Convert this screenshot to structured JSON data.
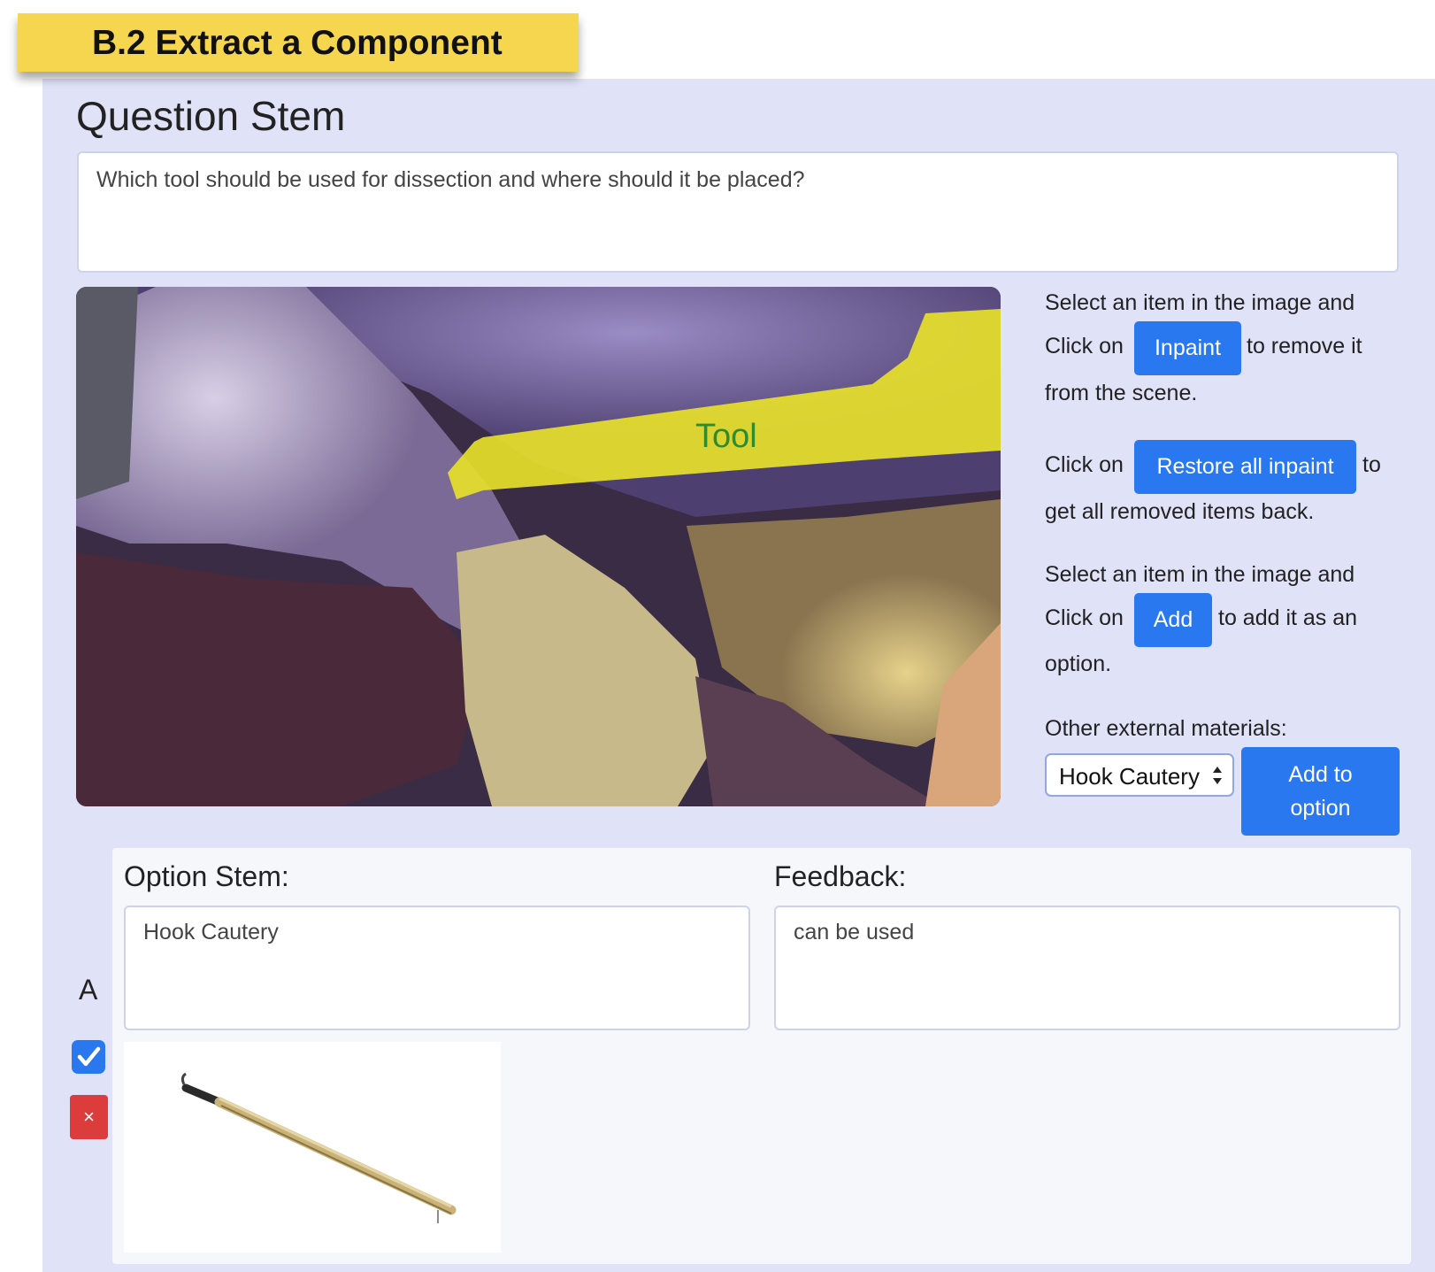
{
  "banner": {
    "title": "B.2 Extract a Component"
  },
  "question": {
    "heading": "Question Stem",
    "text": "Which tool should be used for dissection and where should it be placed?"
  },
  "scene": {
    "overlay_label": "Tool",
    "overlay_color": "#e6e02a"
  },
  "instructions": {
    "block1_line1": "Select an item in the image and",
    "block1_click_on": "Click on",
    "inpaint_button": "Inpaint",
    "block1_after": "to remove it",
    "block1_line3": "from the scene.",
    "block2_click_on": "Click on",
    "restore_button": "Restore all inpaint",
    "block2_after": "to",
    "block2_line2": "get all removed items back.",
    "block3_line1": "Select an item in the image and",
    "block3_click_on": "Click on",
    "add_button": "Add",
    "block3_after": "to add it as an",
    "block3_line3": "option.",
    "external_label": "Other external materials:",
    "external_select_value": "Hook Cautery",
    "add_to_option_line1": "Add to",
    "add_to_option_line2": "option"
  },
  "option": {
    "letter": "A",
    "stem_label": "Option Stem:",
    "stem_value": "Hook Cautery",
    "feedback_label": "Feedback:",
    "feedback_value": "can be used",
    "correct_checked": true,
    "delete_symbol": "×",
    "image_icon": "hook-cautery-image"
  },
  "colors": {
    "accent": "#2a78f0",
    "banner": "#f6d54f",
    "panel": "#e0e2f8",
    "danger": "#dc3c3c"
  }
}
